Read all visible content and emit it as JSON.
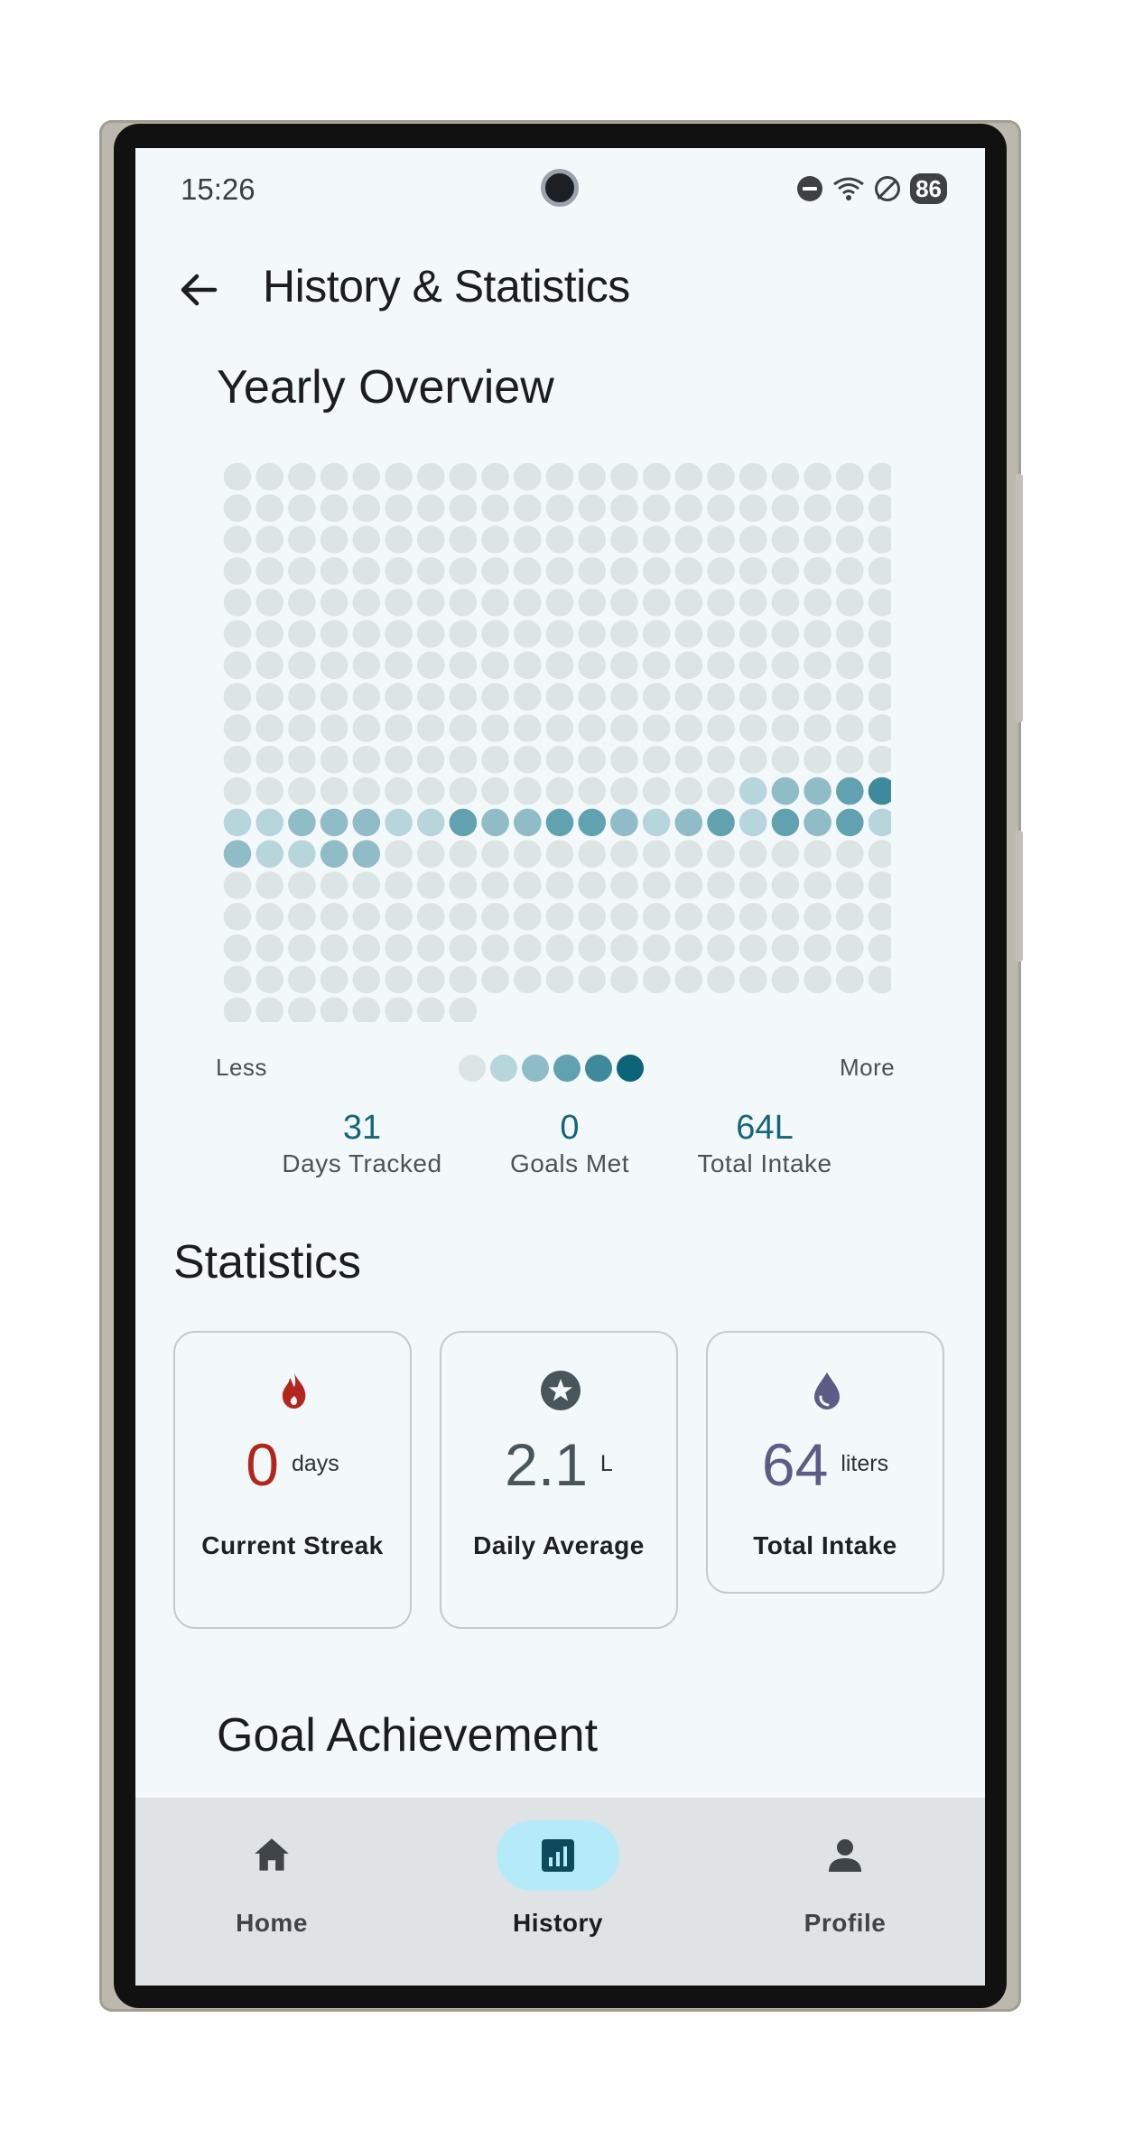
{
  "status_bar": {
    "time": "15:26",
    "battery": "86"
  },
  "app_bar": {
    "title": "History & Statistics",
    "back_icon": "arrow-back-icon"
  },
  "yearly_overview": {
    "title": "Yearly Overview",
    "total_cells": 365,
    "columns": 21,
    "levels_by_day": [
      [
        0,
        0,
        0,
        0,
        0,
        0,
        0,
        0,
        0,
        0,
        0,
        0,
        0,
        0,
        0,
        0,
        0,
        0,
        0,
        0,
        0
      ],
      [
        0,
        0,
        0,
        0,
        0,
        0,
        0,
        0,
        0,
        0,
        0,
        0,
        0,
        0,
        0,
        0,
        0,
        0,
        0,
        0,
        0
      ],
      [
        0,
        0,
        0,
        0,
        0,
        0,
        0,
        0,
        0,
        0,
        0,
        0,
        0,
        0,
        0,
        0,
        0,
        0,
        0,
        0,
        0
      ],
      [
        0,
        0,
        0,
        0,
        0,
        0,
        0,
        0,
        0,
        0,
        0,
        0,
        0,
        0,
        0,
        0,
        0,
        0,
        0,
        0,
        0
      ],
      [
        0,
        0,
        0,
        0,
        0,
        0,
        0,
        0,
        0,
        0,
        0,
        0,
        0,
        0,
        0,
        0,
        0,
        0,
        0,
        0,
        0
      ],
      [
        0,
        0,
        0,
        0,
        0,
        0,
        0,
        0,
        0,
        0,
        0,
        0,
        0,
        0,
        0,
        0,
        0,
        0,
        0,
        0,
        0
      ],
      [
        0,
        0,
        0,
        0,
        0,
        0,
        0,
        0,
        0,
        0,
        0,
        0,
        0,
        0,
        0,
        0,
        0,
        0,
        0,
        0,
        0
      ],
      [
        0,
        0,
        0,
        0,
        0,
        0,
        0,
        0,
        0,
        0,
        0,
        0,
        0,
        0,
        0,
        0,
        0,
        0,
        0,
        0,
        0
      ],
      [
        0,
        0,
        0,
        0,
        0,
        0,
        0,
        0,
        0,
        0,
        0,
        0,
        0,
        0,
        0,
        0,
        0,
        0,
        0,
        0,
        0
      ],
      [
        0,
        0,
        0,
        0,
        0,
        0,
        0,
        0,
        0,
        0,
        0,
        0,
        0,
        0,
        0,
        0,
        0,
        0,
        0,
        0,
        0
      ],
      [
        0,
        0,
        0,
        0,
        0,
        0,
        0,
        0,
        0,
        0,
        0,
        0,
        0,
        0,
        0,
        0,
        1,
        2,
        2,
        3,
        4
      ],
      [
        1,
        1,
        2,
        2,
        2,
        1,
        1,
        3,
        2,
        2,
        3,
        3,
        2,
        1,
        2,
        3,
        1,
        3,
        2,
        3,
        1
      ],
      [
        2,
        1,
        1,
        2,
        2,
        0,
        0,
        0,
        0,
        0,
        0,
        0,
        0,
        0,
        0,
        0,
        0,
        0,
        0,
        0,
        0
      ],
      [
        0,
        0,
        0,
        0,
        0,
        0,
        0,
        0,
        0,
        0,
        0,
        0,
        0,
        0,
        0,
        0,
        0,
        0,
        0,
        0,
        0
      ],
      [
        0,
        0,
        0,
        0,
        0,
        0,
        0,
        0,
        0,
        0,
        0,
        0,
        0,
        0,
        0,
        0,
        0,
        0,
        0,
        0,
        0
      ],
      [
        0,
        0,
        0,
        0,
        0,
        0,
        0,
        0,
        0,
        0,
        0,
        0,
        0,
        0,
        0,
        0,
        0,
        0,
        0,
        0,
        0
      ],
      [
        0,
        0,
        0,
        0,
        0,
        0,
        0,
        0,
        0,
        0,
        0,
        0,
        0,
        0,
        0,
        0,
        0,
        0,
        0,
        0,
        0
      ],
      [
        0,
        0,
        0,
        0,
        0,
        0,
        0,
        0
      ]
    ],
    "level_colors": [
      "#dde4e6",
      "#b6d6dc",
      "#8fbcc6",
      "#62a1b0",
      "#3e8a9c",
      "#0c6478"
    ],
    "legend": {
      "less_label": "Less",
      "more_label": "More"
    },
    "summary": [
      {
        "value": "31",
        "label": "Days Tracked"
      },
      {
        "value": "0",
        "label": "Goals Met"
      },
      {
        "value": "64L",
        "label": "Total Intake"
      }
    ]
  },
  "statistics": {
    "title": "Statistics",
    "cards": [
      {
        "icon": "fire-icon",
        "value": "0",
        "unit": "days",
        "label": "Current Streak",
        "color": "#b3261e"
      },
      {
        "icon": "star-icon",
        "value": "2.1",
        "unit": "L",
        "label": "Daily Average",
        "color": "#48565c"
      },
      {
        "icon": "water-drop-icon",
        "value": "64",
        "unit": "liters",
        "label": "Total Intake",
        "color": "#5c5c87"
      }
    ]
  },
  "goal_achievement": {
    "title": "Goal Achievement"
  },
  "bottom_nav": {
    "items": [
      {
        "icon": "home-icon",
        "label": "Home",
        "active": false
      },
      {
        "icon": "bar-chart-icon",
        "label": "History",
        "active": true
      },
      {
        "icon": "person-icon",
        "label": "Profile",
        "active": false
      }
    ]
  },
  "colors": {
    "accent": "#14667a",
    "screen_background": "#f3f8fa",
    "nav_active_pill": "#b5ebf8"
  }
}
